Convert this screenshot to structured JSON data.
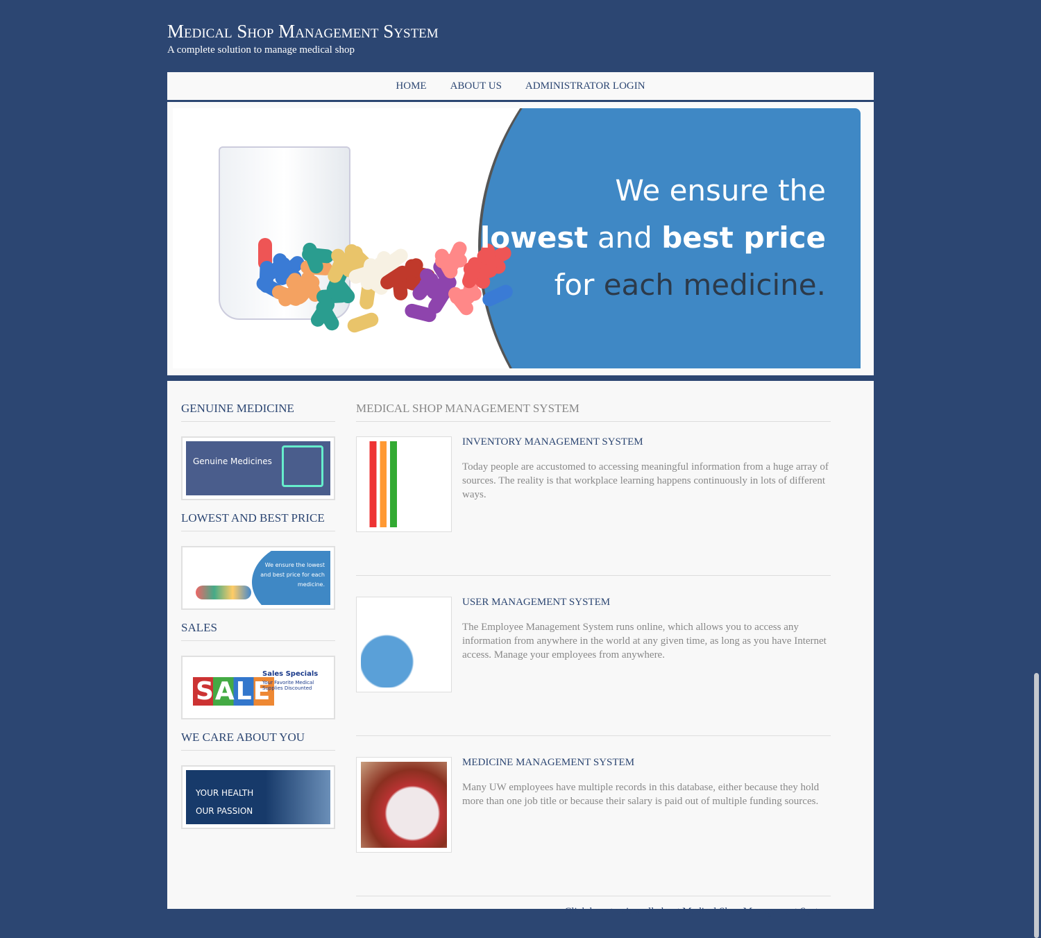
{
  "header": {
    "title": "Medical Shop Management System",
    "subtitle": "A complete solution to manage medical shop"
  },
  "nav": [
    {
      "label": "HOME"
    },
    {
      "label": "ABOUT US"
    },
    {
      "label": "ADMINISTRATOR LOGIN"
    }
  ],
  "banner": {
    "line1": "We ensure the",
    "line2a": "lowest",
    "line2b": " and ",
    "line2c": "best price",
    "line3a": "for ",
    "line3b": "each medicine."
  },
  "sidebar": [
    {
      "heading": "GENUINE MEDICINE",
      "image_text": "Genuine Medicines"
    },
    {
      "heading": "LOWEST AND BEST PRICE",
      "image_text": "We ensure the lowest and best price for each medicine."
    },
    {
      "heading": "SALES",
      "image_text": "Sales Specials",
      "image_sub": "Your Favorite Medical Supplies Discounted",
      "image_word": "SALE"
    },
    {
      "heading": "WE CARE ABOUT YOU",
      "image_text": "YOUR HEALTH",
      "image_sub": "OUR PASSION"
    }
  ],
  "main": {
    "heading": "MEDICAL SHOP MANAGEMENT SYSTEM",
    "items": [
      {
        "title": "INVENTORY MANAGEMENT SYSTEM",
        "text": "Today people are accustomed to accessing meaningful information from a huge array of sources. The reality is that workplace learning happens continuously in lots of different ways."
      },
      {
        "title": "USER MANAGEMENT SYSTEM",
        "text": "The Employee Management System runs online, which allows you to access any information from anywhere in the world at any given time, as long as you have Internet access. Manage your employees from anywhere."
      },
      {
        "title": "MEDICINE MANAGEMENT SYSTEM",
        "text": "Many UW employees have multiple records in this database, either because they hold more than one job title or because their salary is paid out of multiple funding sources."
      }
    ],
    "more_link": "Click here to view all about Medical Shop Management System"
  },
  "colors": {
    "background": "#2c4672",
    "accent": "#3f88c5"
  }
}
